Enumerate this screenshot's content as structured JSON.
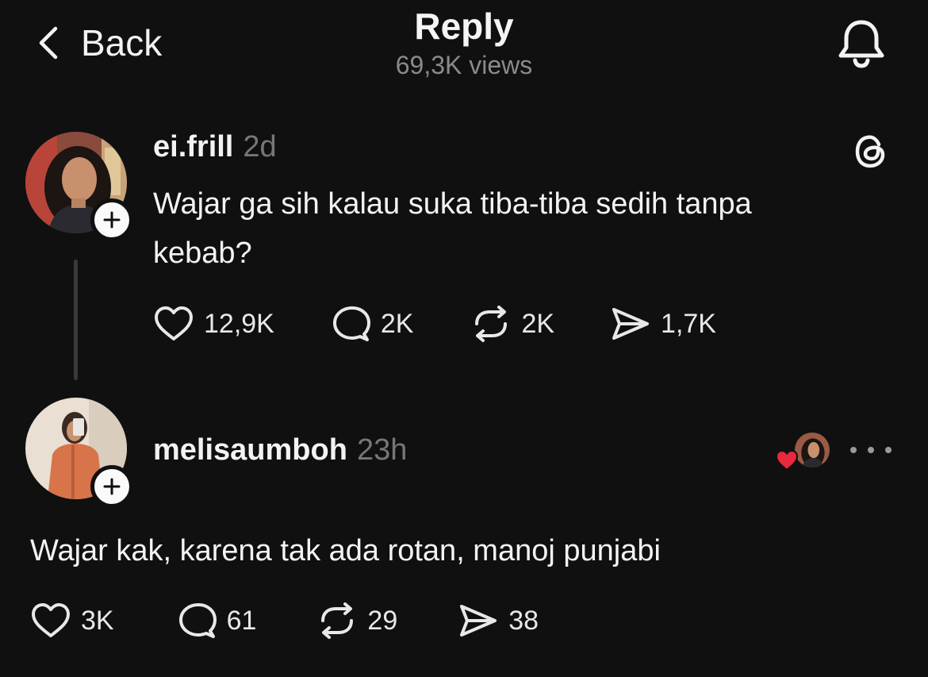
{
  "header": {
    "back_label": "Back",
    "title": "Reply",
    "views": "69,3K views"
  },
  "post": {
    "username": "ei.frill",
    "time": "2d",
    "text_line1": "Wajar ga sih kalau suka tiba-tiba sedih tanpa",
    "text_line2": "kebab?",
    "likes": "12,9K",
    "replies": "2K",
    "reposts": "2K",
    "shares": "1,7K"
  },
  "reply": {
    "username": "melisaumboh",
    "time": "23h",
    "text": "Wajar kak, karena tak ada rotan, manoj punjabi",
    "likes": "3K",
    "replies": "61",
    "reposts": "29",
    "shares": "38"
  },
  "icons": {
    "back": "chevron-left-icon",
    "bell": "bell-icon",
    "threads": "threads-logo-icon",
    "like": "heart-icon",
    "reply": "comment-icon",
    "repost": "repost-icon",
    "share": "send-icon",
    "more": "more-dots-icon"
  },
  "colors": {
    "background": "#101010",
    "text": "#f3f3f3",
    "muted": "#8a8a8a",
    "liked_heart": "#e8283c"
  }
}
